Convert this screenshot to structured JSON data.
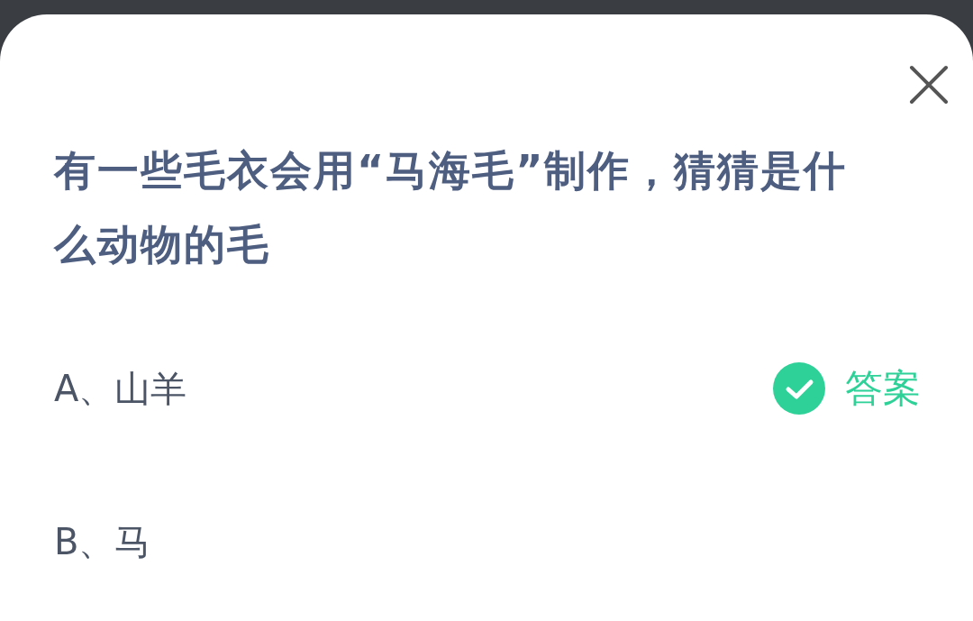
{
  "question": "有一些毛衣会用“马海毛”制作，猜猜是什么动物的毛",
  "options": [
    {
      "label": "A、山羊",
      "correct": true
    },
    {
      "label": "B、马",
      "correct": false
    }
  ],
  "answer_label": "答案"
}
